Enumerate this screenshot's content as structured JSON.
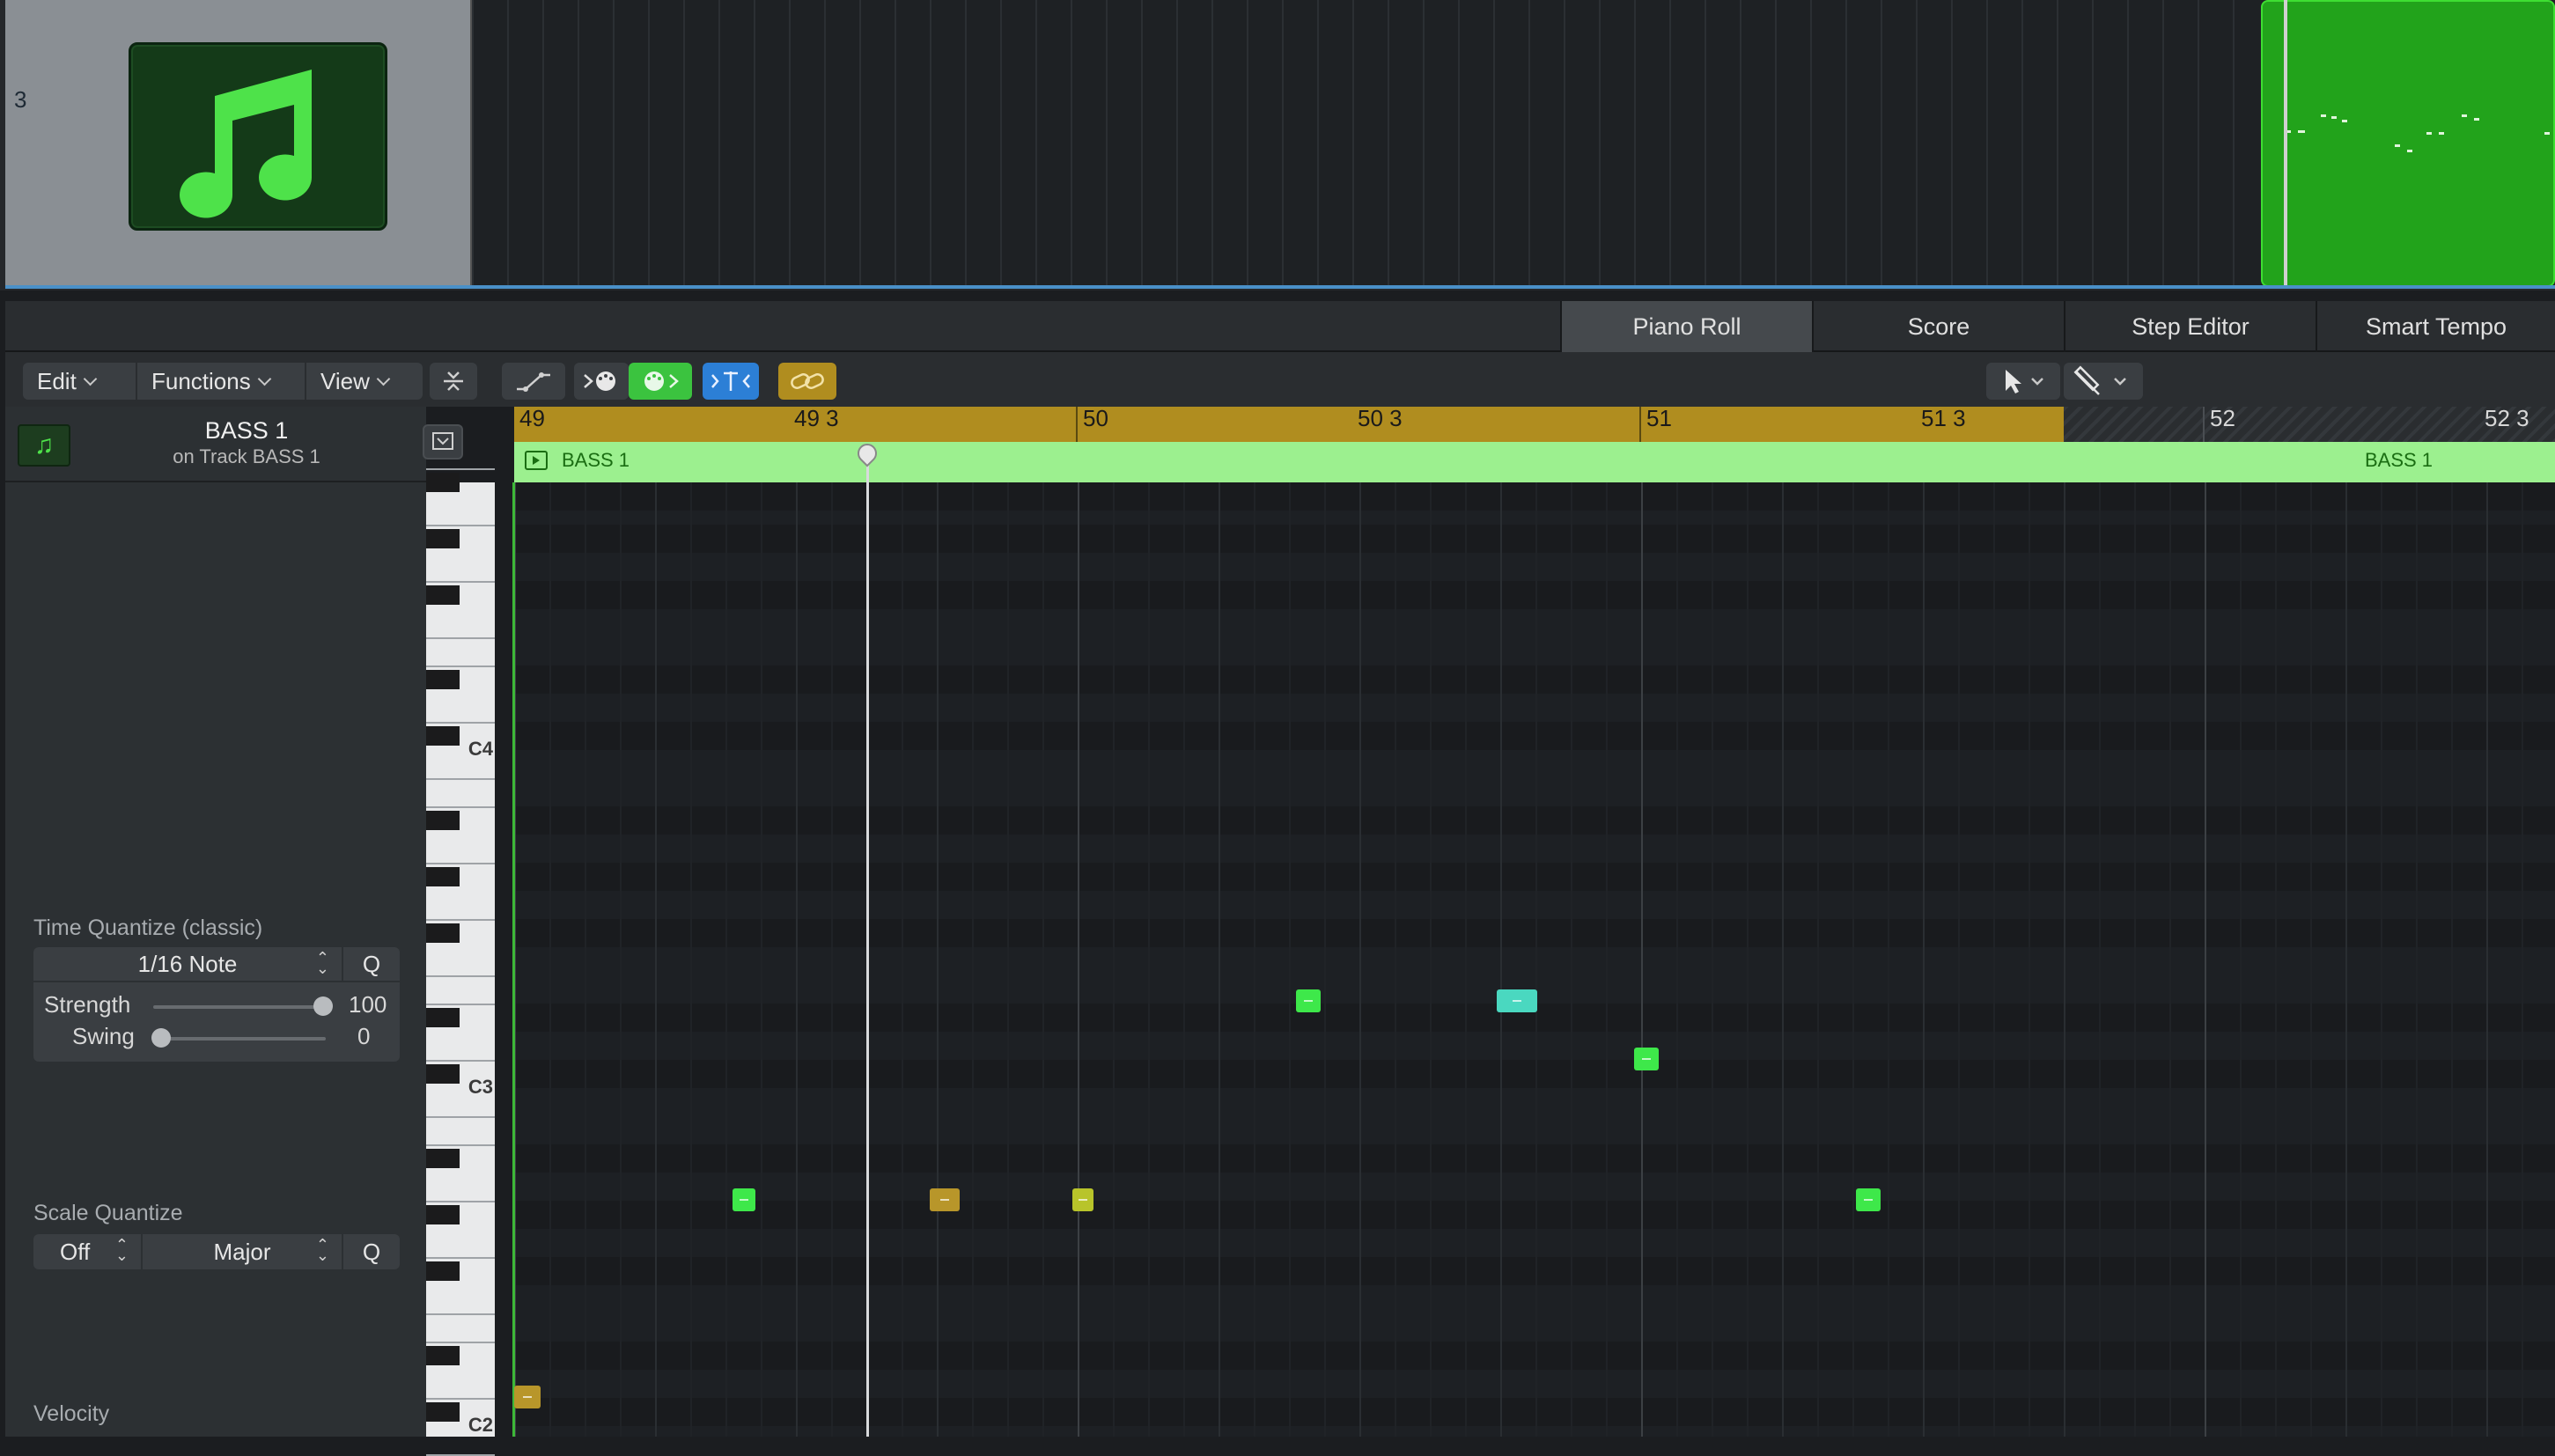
{
  "track": {
    "number": "3",
    "icon": "music-note-icon"
  },
  "tabs": [
    {
      "label": "Piano Roll",
      "active": true
    },
    {
      "label": "Score",
      "active": false
    },
    {
      "label": "Step Editor",
      "active": false
    },
    {
      "label": "Smart Tempo",
      "active": false
    }
  ],
  "toolbar": {
    "edit": "Edit",
    "functions": "Functions",
    "view": "View"
  },
  "inspector": {
    "region_name": "BASS 1",
    "region_sub": "on Track BASS 1",
    "time_quantize": {
      "title": "Time Quantize (classic)",
      "value": "1/16 Note",
      "q": "Q",
      "strength_label": "Strength",
      "strength_value": "100",
      "strength_level": 1.0,
      "swing_label": "Swing",
      "swing_value": "0",
      "swing_level": 0.0
    },
    "scale_quantize": {
      "title": "Scale Quantize",
      "root": "Off",
      "scale": "Major",
      "q": "Q"
    },
    "velocity_title": "Velocity"
  },
  "piano": {
    "labels": [
      "C4",
      "C3",
      "C2"
    ]
  },
  "ruler": {
    "bars": [
      "49",
      "49 3",
      "50",
      "50 3",
      "51",
      "51 3",
      "52",
      "52 3"
    ]
  },
  "region": {
    "name": "BASS 1",
    "name_end": "BASS 1"
  },
  "colors": {
    "accent_green": "#22a31b",
    "ruler_gold": "#b08d1f",
    "note_green": "#3ee84a",
    "note_teal": "#4ad8c0",
    "note_gold": "#b8962a",
    "note_olive": "#b8c42a"
  }
}
